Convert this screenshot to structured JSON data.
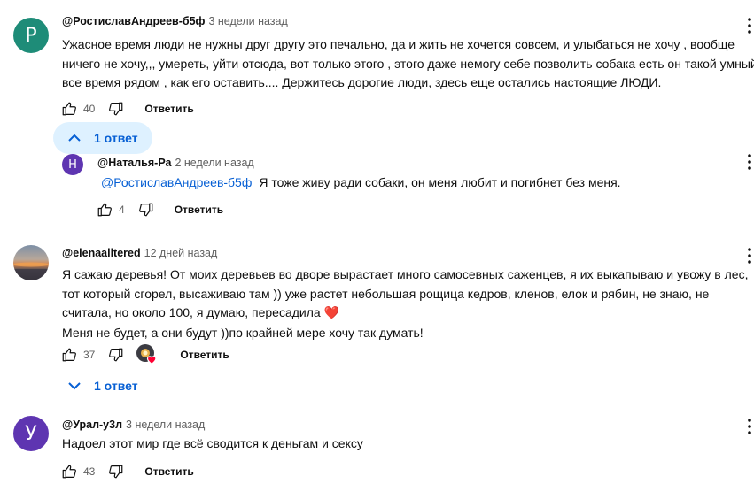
{
  "comments": [
    {
      "author": "@РостиславАндреев-б5ф",
      "time": "3 недели назад",
      "avatar_letter": "Р",
      "avatar_color": "#1e8c78",
      "lines": [
        "Ужасное время  люди не нужны друг другу это печально, да и жить не хочется совсем, и улыбаться не хочу , вообще",
        "ничего не хочу,,, умереть, уйти отсюда, вот только этого , этого даже немогу себе позволить собака есть он такой умный",
        "все время рядом , как его оставить.... Держитесь дорогие люди, здесь еще остались настоящие ЛЮДИ."
      ],
      "likes": "40",
      "reply_label": "Ответить",
      "replies_label": "1 ответ"
    },
    {
      "author": "@Наталья-Ра",
      "time": "2 недели назад",
      "avatar_letter": "Н",
      "avatar_color": "#5e35b1",
      "mention": "@РостиславАндреев-б5ф",
      "text": "Я тоже живу ради собаки, он меня любит и погибнет без меня.",
      "likes": "4",
      "reply_label": "Ответить"
    },
    {
      "author": "@elenaalltered",
      "time": "12 дней назад",
      "lines": [
        "Я сажаю деревья! От моих деревьев во дворе вырастает много самосевных саженцев, я их выкапываю и увожу в лес,",
        "тот который сгорел, высаживаю там )) уже растет небольшая рощица кедров, кленов, елок и рябин, не знаю, не",
        "считала, но около 100, я думаю, пересадила ",
        "Меня не будет, а они будут ))по крайней мере хочу так думать!"
      ],
      "emoji": "❤️",
      "likes": "37",
      "reply_label": "Ответить",
      "replies_label": "1 ответ"
    },
    {
      "author": "@Урал-у3л",
      "time": "3 недели назад",
      "avatar_letter": "У",
      "avatar_color": "#5e35b1",
      "text": "Надоел этот мир где всё сводится к деньгам и сексу",
      "likes": "43",
      "reply_label": "Ответить"
    }
  ],
  "icons": {
    "like": "thumbs-up-icon",
    "dislike": "thumbs-down-icon",
    "menu": "more-vert-icon",
    "replies_open": "chevron-up-icon",
    "replies_closed": "chevron-down-icon",
    "creator_heart": "creator-heart-icon"
  }
}
